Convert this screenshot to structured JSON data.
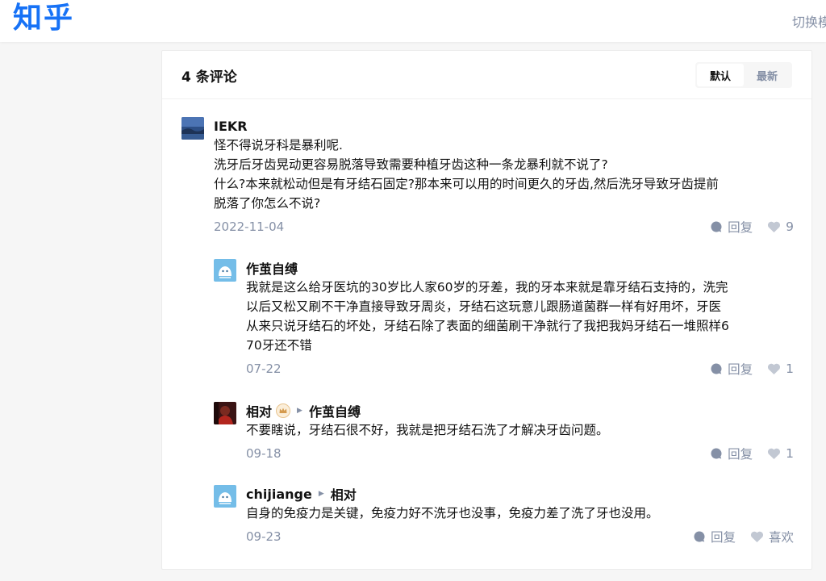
{
  "header": {
    "logo": "知乎",
    "switch_link": "切换模"
  },
  "comments_panel": {
    "count_label": "4 条评论",
    "sort": {
      "default_label": "默认",
      "latest_label": "最新"
    },
    "reply_label": "回复",
    "comments": [
      {
        "author": "IEKR",
        "text": "怪不得说牙科是暴利呢.\n洗牙后牙齿晃动更容易脱落导致需要种植牙齿这种一条龙暴利就不说了?\n什么?本来就松动但是有牙结石固定?那本来可以用的时间更久的牙齿,然后洗牙导致牙齿提前\n脱落了你怎么不说?",
        "date": "2022-11-04",
        "likes": "9"
      },
      {
        "author": "作茧自缚",
        "text": "我就是这么给牙医坑的30岁比人家60岁的牙差，我的牙本来就是靠牙结石支持的，洗完\n以后又松又刷不干净直接导致牙周炎，牙结石这玩意儿跟肠道菌群一样有好用坏，牙医\n从来只说牙结石的坏处，牙结石除了表面的细菌刷干净就行了我把我妈牙结石一堆照样6\n70牙还不错",
        "date": "07-22",
        "likes": "1"
      },
      {
        "author": "相对",
        "reply_to": "作茧自缚",
        "text": "不要瞎说，牙结石很不好，我就是把牙结石洗了才解决牙齿问题。",
        "date": "09-18",
        "likes": "1"
      },
      {
        "author": "chijiange",
        "reply_to": "相对",
        "text": "自身的免疫力是关键，免疫力好不洗牙也没事，免疫力差了洗了牙也没用。",
        "date": "09-23",
        "likes": "喜欢"
      }
    ]
  },
  "colors": {
    "brand": "#1772f6",
    "muted": "#8590a6",
    "text": "#121212"
  }
}
